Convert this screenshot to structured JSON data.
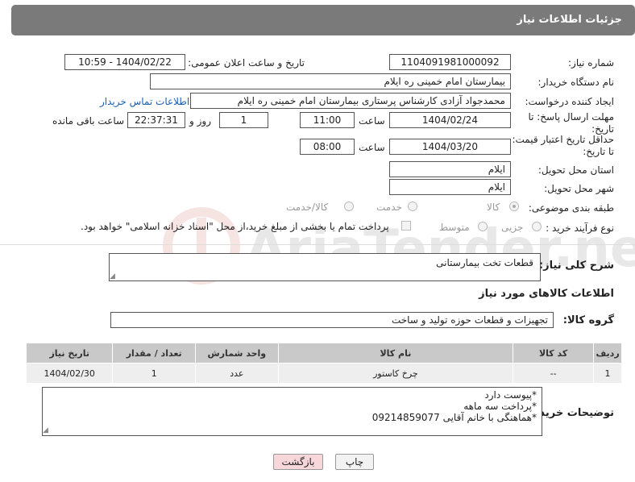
{
  "header": {
    "title": "جزئیات اطلاعات نیاز"
  },
  "need_number": {
    "label": "شماره نیاز:",
    "value": "1104091981000092"
  },
  "announce": {
    "label": "تاریخ و ساعت اعلان عمومی:",
    "value": "1404/02/22 - 10:59"
  },
  "buyer_org": {
    "label": "نام دستگاه خریدار:",
    "value": "بیمارستان امام خمینی  ره  ایلام"
  },
  "requester": {
    "label": "ایجاد کننده درخواست:",
    "value": "محمدجواد آزادی کارشناس پرستاری بیمارستان امام خمینی  ره  ایلام",
    "contact_link": "اطلاعات تماس خریدار"
  },
  "deadline": {
    "label": "مهلت ارسال پاسخ: تا تاریخ:",
    "date": "1404/02/24",
    "time_label": "ساعت",
    "time": "11:00",
    "days": "1",
    "days_label": "روز و",
    "remaining": "22:37:31",
    "remaining_label": "ساعت باقی مانده"
  },
  "validity": {
    "label": "حداقل تاریخ اعتبار قیمت: تا تاریخ:",
    "date": "1404/03/20",
    "time_label": "ساعت",
    "time": "08:00"
  },
  "province": {
    "label": "استان محل تحویل:",
    "value": "ایلام"
  },
  "city": {
    "label": "شهر محل تحویل:",
    "value": "ایلام"
  },
  "category": {
    "label": "طبقه بندی موضوعی:",
    "options": [
      "کالا",
      "خدمت",
      "کالا/خدمت"
    ]
  },
  "process": {
    "label": "نوع فرآیند خرید :",
    "options": [
      "جزیی",
      "متوسط"
    ],
    "note": "پرداخت تمام یا بخشی از مبلغ خرید،از محل \"اسناد خزانه اسلامی\" خواهد بود."
  },
  "description": {
    "label": "شرح کلی نیاز:",
    "value": "قطعات تخت بیمارستانی"
  },
  "goods_section": {
    "title": "اطلاعات کالاهای مورد نیاز"
  },
  "goods_group": {
    "label": "گروه کالا:",
    "value": "تجهیزات و قطعات حوزه تولید و ساخت"
  },
  "table": {
    "headers": [
      "ردیف",
      "کد کالا",
      "نام کالا",
      "واحد شمارش",
      "تعداد / مقدار",
      "تاریخ نیاز"
    ],
    "rows": [
      [
        "1",
        "--",
        "چرخ کاستور",
        "عدد",
        "1",
        "1404/02/30"
      ]
    ]
  },
  "buyer_notes": {
    "label": "توضیحات خریدار:",
    "lines": [
      "*پیوست دارد",
      "*پرداخت سه ماهه",
      "*هماهنگی با خانم آقایی 09214859077"
    ]
  },
  "buttons": {
    "print": "چاپ",
    "back": "بازگشت"
  },
  "watermark": {
    "text": "AriaTender.neT"
  },
  "colors": {
    "header_bg": "#7a7a7a",
    "link": "#1a5fb4",
    "table_header": "#c9c9c9",
    "back_button": "#f8d7da"
  }
}
